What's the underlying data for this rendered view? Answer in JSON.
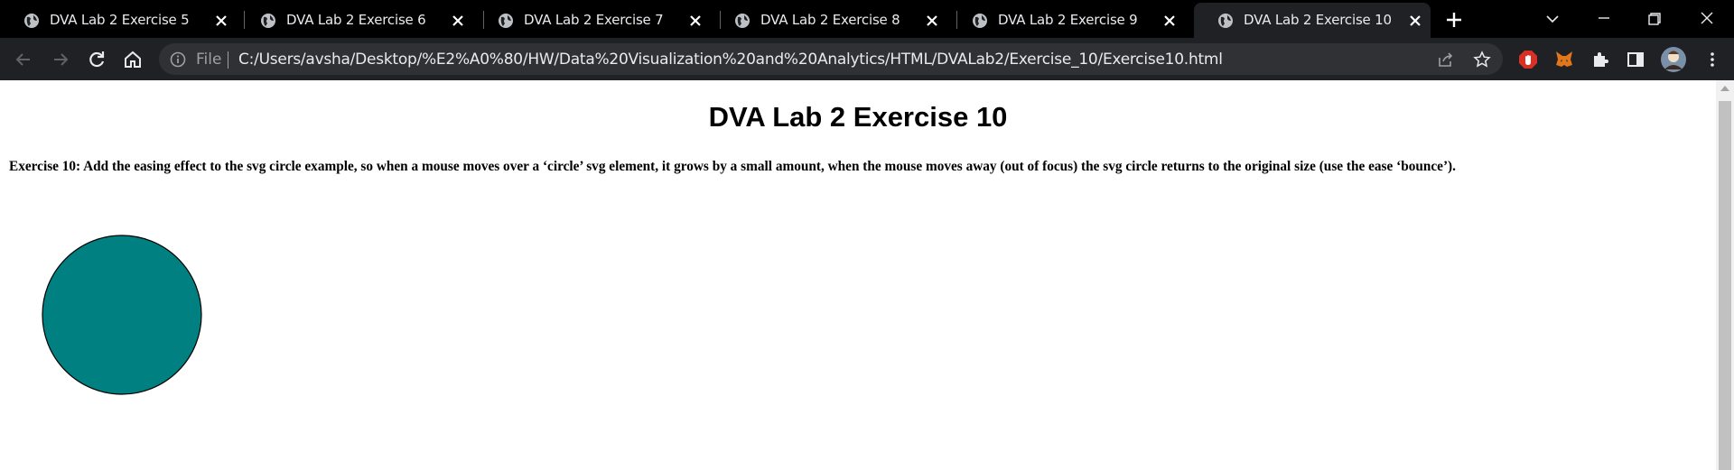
{
  "browser": {
    "tabs": [
      {
        "title": "DVA Lab 2 Exercise 5",
        "active": false
      },
      {
        "title": "DVA Lab 2 Exercise 6",
        "active": false
      },
      {
        "title": "DVA Lab 2 Exercise 7",
        "active": false
      },
      {
        "title": "DVA Lab 2 Exercise 8",
        "active": false
      },
      {
        "title": "DVA Lab 2 Exercise 9",
        "active": false
      },
      {
        "title": "DVA Lab 2 Exercise 10",
        "active": true
      }
    ],
    "address": {
      "scheme_label": "File",
      "url": "C:/Users/avsha/Desktop/%E2%A0%80/HW/Data%20Visualization%20and%20Analytics/HTML/DVALab2/Exercise_10/Exercise10.html"
    }
  },
  "page": {
    "heading": "DVA Lab 2 Exercise 10",
    "exercise": "Exercise 10: Add the easing effect to the svg circle example, so when a mouse moves over a ‘circle’ svg element, it grows by a small amount, when the mouse moves away (out of focus) the svg circle returns to the original size (use the ease ‘bounce’).",
    "circle_fill": "#008080",
    "circle_stroke": "#000000"
  },
  "colors": {
    "tabstrip": "#000000",
    "toolbar": "#202124",
    "omnibox": "#303134"
  }
}
